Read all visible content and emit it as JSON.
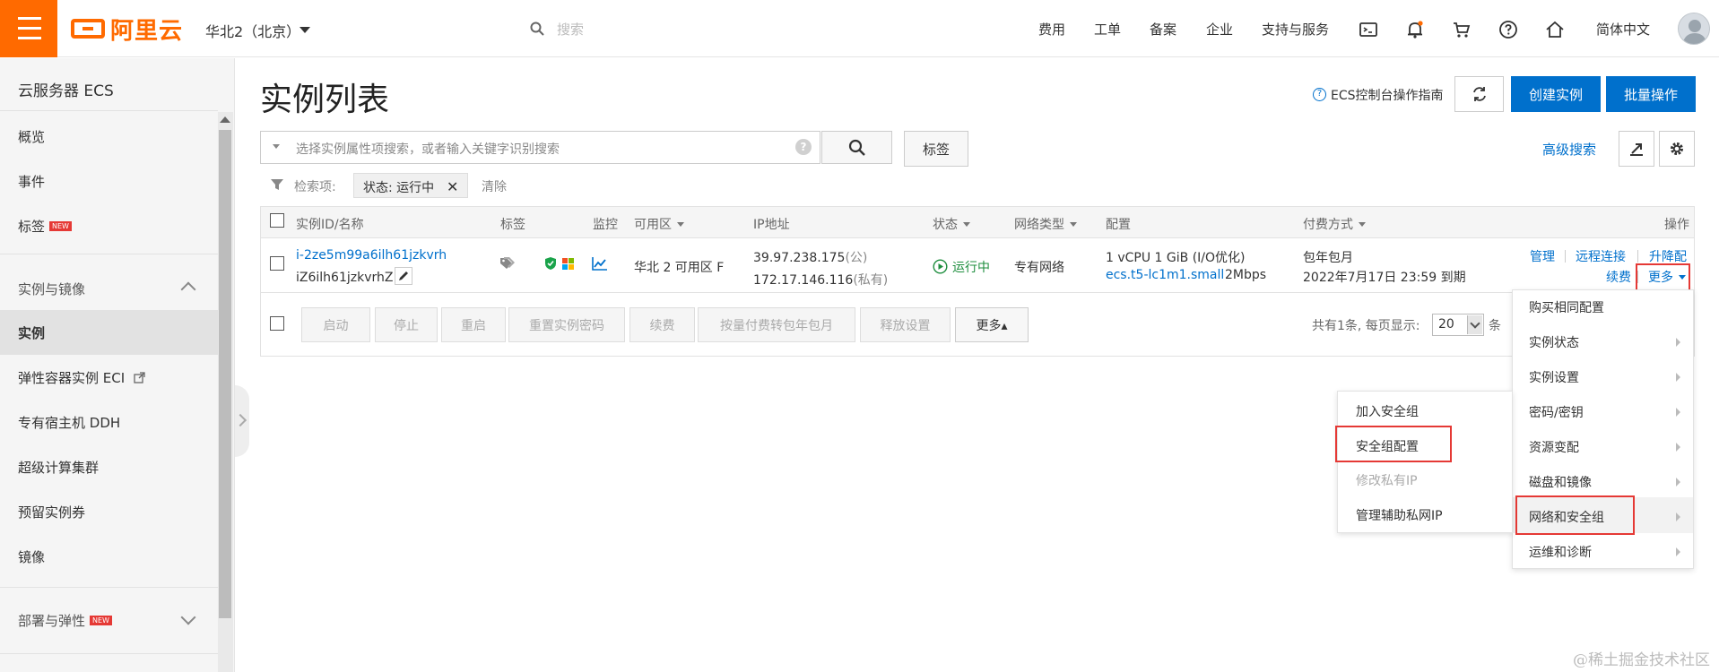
{
  "topbar": {
    "logo_text": "阿里云",
    "region": "华北2（北京）",
    "search_placeholder": "搜索",
    "nav": [
      "费用",
      "工单",
      "备案",
      "企业",
      "支持与服务"
    ],
    "language": "简体中文",
    "icons": [
      "terminal-icon",
      "bell-icon",
      "cart-icon",
      "help-icon",
      "home-icon"
    ],
    "accent_color": "#ff6a00"
  },
  "sidebar": {
    "title": "云服务器 ECS",
    "items": [
      {
        "label": "概览"
      },
      {
        "label": "事件"
      },
      {
        "label": "标签",
        "badge": "NEW"
      }
    ],
    "group_instances": "实例与镜像",
    "instance_items": [
      {
        "label": "实例",
        "active": true
      },
      {
        "label": "弹性容器实例 ECI",
        "external": true
      },
      {
        "label": "专有宿主机 DDH"
      },
      {
        "label": "超级计算集群"
      },
      {
        "label": "预留实例券"
      },
      {
        "label": "镜像"
      }
    ],
    "group_deploy": "部署与弹性",
    "group_deploy_badge": "NEW"
  },
  "main": {
    "title": "实例列表",
    "guide_link": "ECS控制台操作指南",
    "create_button": "创建实例",
    "batch_button": "批量操作",
    "filter_placeholder": "选择实例属性项搜索，或者输入关键字识别搜索",
    "help_glyph": "?",
    "tag_button": "标签",
    "advanced_search": "高级搜索",
    "criteria_label": "检索项:",
    "criteria_chip": "状态: 运行中",
    "criteria_remove": "✕",
    "clear_link": "清除"
  },
  "table": {
    "columns": [
      "实例ID/名称",
      "标签",
      "监控",
      "可用区",
      "IP地址",
      "状态",
      "网络类型",
      "配置",
      "付费方式",
      "操作"
    ],
    "rows": [
      {
        "instance_id": "i-2ze5m99a6ilh61jzkvrh",
        "instance_name": "iZ6ilh61jzkvrhZ",
        "zone": "华北 2 可用区 F",
        "public_ip": "39.97.238.175",
        "public_suffix": "(公)",
        "private_ip": "172.17.146.116",
        "private_suffix": "(私有)",
        "status": "运行中",
        "network": "专有网络",
        "config_line1": "1 vCPU 1 GiB (I/O优化)",
        "config_type": "ecs.t5-lc1m1.small",
        "bandwidth": "2Mbps",
        "billing": "包年包月",
        "expire": "2022年7月17日 23:59 到期",
        "actions": [
          "管理",
          "远程连接",
          "升降配",
          "续费",
          "更多"
        ]
      }
    ],
    "status_color": "#1e8e3e"
  },
  "bulk_actions": [
    "启动",
    "停止",
    "重启",
    "重置实例密码",
    "续费",
    "按量付费转包年包月",
    "释放设置"
  ],
  "bulk_more": "更多▴",
  "pager": {
    "text": "共有1条, 每页显示:",
    "page_size": "20",
    "unit": "条"
  },
  "more_menu": {
    "items": [
      "购买相同配置",
      "实例状态",
      "实例设置",
      "密码/密钥",
      "资源变配",
      "磁盘和镜像",
      "网络和安全组",
      "运维和诊断"
    ],
    "active": "网络和安全组"
  },
  "sub_menu": {
    "items": [
      "加入安全组",
      "安全组配置",
      "修改私有IP",
      "管理辅助私网IP"
    ],
    "disabled": [
      "修改私有IP"
    ]
  },
  "watermark": "@稀土掘金技术社区"
}
